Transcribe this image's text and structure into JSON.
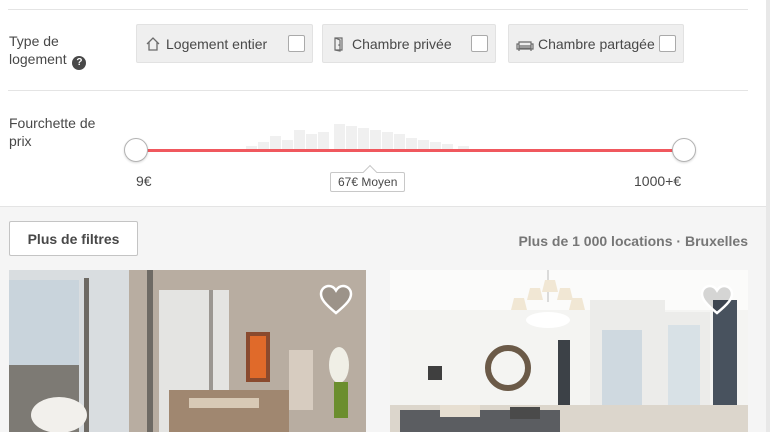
{
  "room_type": {
    "label": "Type de logement",
    "help_icon": "question-circle-icon",
    "options": [
      {
        "label": "Logement entier",
        "icon": "house-icon",
        "checked": false
      },
      {
        "label": "Chambre privée",
        "icon": "door-icon",
        "checked": false
      },
      {
        "label": "Chambre partagée",
        "icon": "couch-icon",
        "checked": false
      }
    ]
  },
  "price_range": {
    "label": "Fourchette de prix",
    "min_label": "9€",
    "max_label": "1000+€",
    "average_label": "67€ Moyen",
    "accent_color": "#f0585e"
  },
  "results": {
    "more_filters_label": "Plus de filtres",
    "count_label": "Plus de 1 000 locations · Bruxelles"
  },
  "listings": [
    {
      "favorite_icon": "heart-outline-icon"
    },
    {
      "favorite_icon": "heart-outline-icon"
    }
  ]
}
